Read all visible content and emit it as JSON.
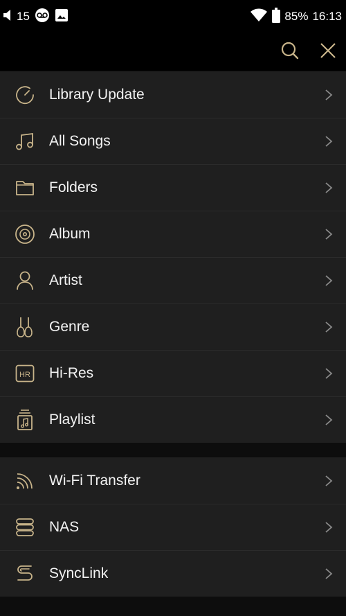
{
  "status_bar": {
    "notification_count": "15",
    "battery_percent": "85%",
    "time": "16:13",
    "icons": [
      "volume-icon",
      "voicemail-icon",
      "image-icon",
      "wifi-icon",
      "battery-icon"
    ]
  },
  "top_bar": {
    "actions": [
      "search-icon",
      "close-icon"
    ]
  },
  "colors": {
    "accent": "#c8b48a",
    "background": "#0d0d0d",
    "panel": "#1f1f1f",
    "text": "#f2f2f2"
  },
  "sections": [
    {
      "items": [
        {
          "label": "Library Update",
          "icon": "refresh-gauge-icon"
        },
        {
          "label": "All Songs",
          "icon": "music-note-icon"
        },
        {
          "label": "Folders",
          "icon": "folder-icon"
        },
        {
          "label": "Album",
          "icon": "disc-icon"
        },
        {
          "label": "Artist",
          "icon": "person-icon"
        },
        {
          "label": "Genre",
          "icon": "guitar-icon"
        },
        {
          "label": "Hi-Res",
          "icon": "hr-badge-icon",
          "icon_text": "HR"
        },
        {
          "label": "Playlist",
          "icon": "playlist-icon"
        }
      ]
    },
    {
      "items": [
        {
          "label": "Wi-Fi Transfer",
          "icon": "wifi-transfer-icon"
        },
        {
          "label": "NAS",
          "icon": "storage-icon"
        },
        {
          "label": "SyncLink",
          "icon": "synclink-icon"
        }
      ]
    }
  ]
}
